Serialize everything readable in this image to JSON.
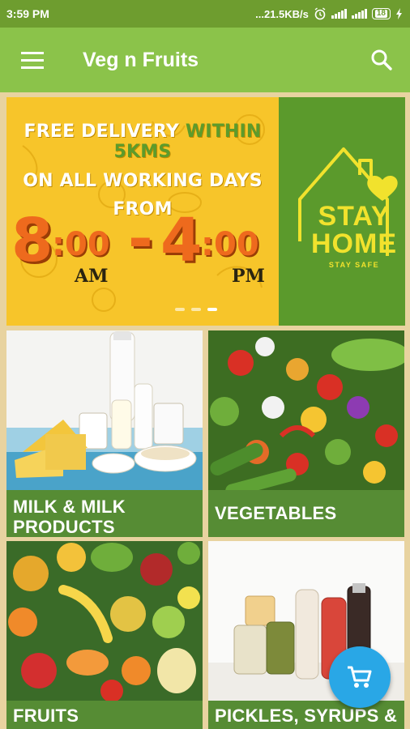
{
  "status_bar": {
    "time": "3:59 PM",
    "net_speed": "...21.5KB/s",
    "battery": "18",
    "icons": [
      "alarm-icon",
      "signal-icon",
      "wifi-icon",
      "battery-icon",
      "charging-icon"
    ]
  },
  "app_bar": {
    "title": "Veg n Fruits",
    "menu_icon": "menu-icon",
    "search_icon": "search-icon"
  },
  "banner": {
    "line1_a": "FREE DELIVERY",
    "line1_b": "WITHIN 5KMS",
    "line2": "ON ALL WORKING DAYS",
    "line3": "FROM",
    "start_hour": "8",
    "start_minutes": ":00",
    "start_period": "AM",
    "dash": "-",
    "end_hour": "4",
    "end_minutes": ":00",
    "end_period": "PM",
    "stay": "STAY",
    "home": "HOME",
    "stay_safe": "STAY SAFE",
    "slides": 3,
    "active_slide": 3
  },
  "categories": [
    {
      "label": "MILK & MILK PRODUCTS"
    },
    {
      "label": "VEGETABLES"
    },
    {
      "label": "FRUITS"
    },
    {
      "label": "PICKLES, SYRUPS &"
    }
  ],
  "fab": {
    "icon": "cart-icon"
  },
  "colors": {
    "status_bar": "#6e9d2f",
    "app_bar": "#8bc34a",
    "label_bg": "#568c34",
    "banner_yellow": "#f7c52a",
    "banner_green": "#5b9a2c",
    "fab": "#29a7e6"
  }
}
